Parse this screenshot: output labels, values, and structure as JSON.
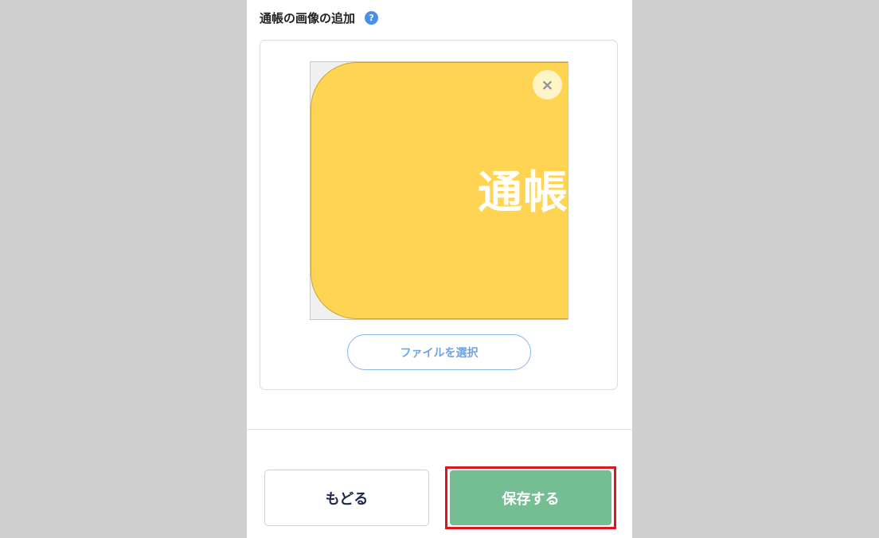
{
  "section": {
    "title": "通帳の画像の追加",
    "help_icon": "?"
  },
  "preview": {
    "image_text": "通帳",
    "close_glyph": "×",
    "bg_color": "#ffd452"
  },
  "upload": {
    "file_button_label": "ファイルを選択"
  },
  "footer": {
    "back_label": "もどる",
    "save_label": "保存する",
    "save_color": "#75be93",
    "highlight_color": "#e0141b"
  }
}
